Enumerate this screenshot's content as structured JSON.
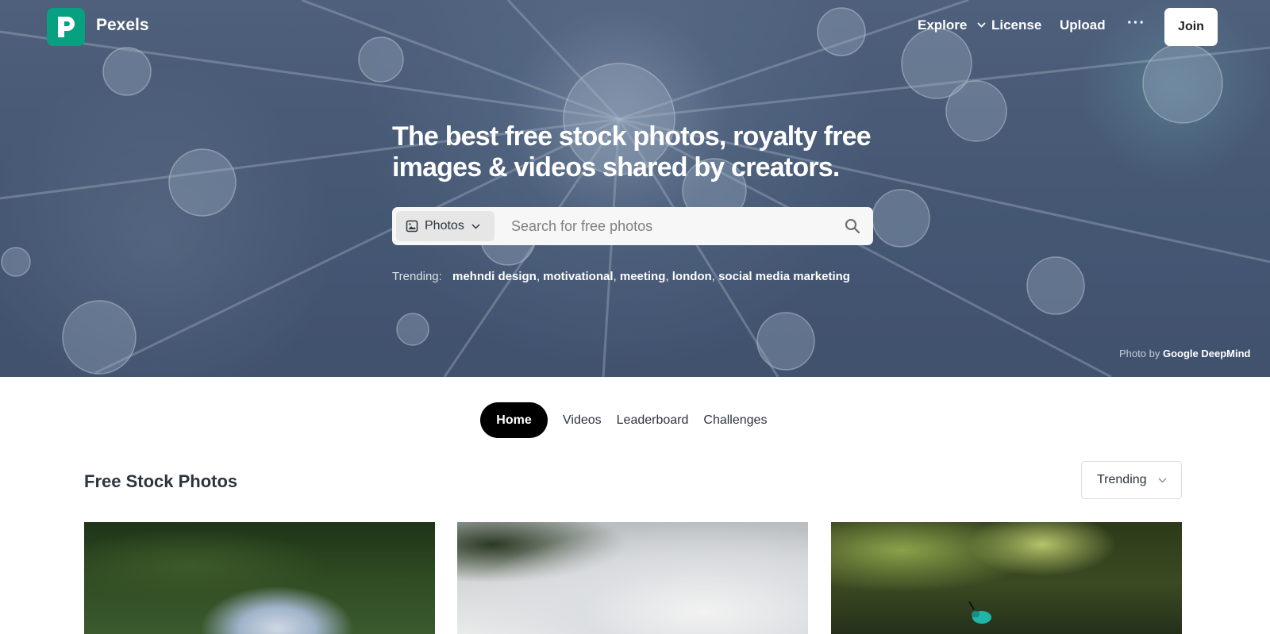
{
  "brand": {
    "name": "Pexels",
    "color": "#07a081"
  },
  "nav": {
    "explore": "Explore",
    "license": "License",
    "upload": "Upload",
    "more": "···",
    "join": "Join"
  },
  "hero": {
    "headline_line1": "The best free stock photos, royalty free",
    "headline_line2": "images & videos shared by creators.",
    "search": {
      "type_label": "Photos",
      "type_icon": "image-icon",
      "placeholder": "Search for free photos"
    },
    "trending": {
      "label": "Trending:",
      "terms": [
        "mehndi design",
        "motivational",
        "meeting",
        "london",
        "social media marketing"
      ]
    },
    "credit": {
      "prefix": "Photo by",
      "author": "Google DeepMind"
    }
  },
  "tabs": [
    "Home",
    "Videos",
    "Leaderboard",
    "Challenges"
  ],
  "active_tab": "Home",
  "section": {
    "title": "Free Stock Photos",
    "sort_label": "Trending"
  }
}
